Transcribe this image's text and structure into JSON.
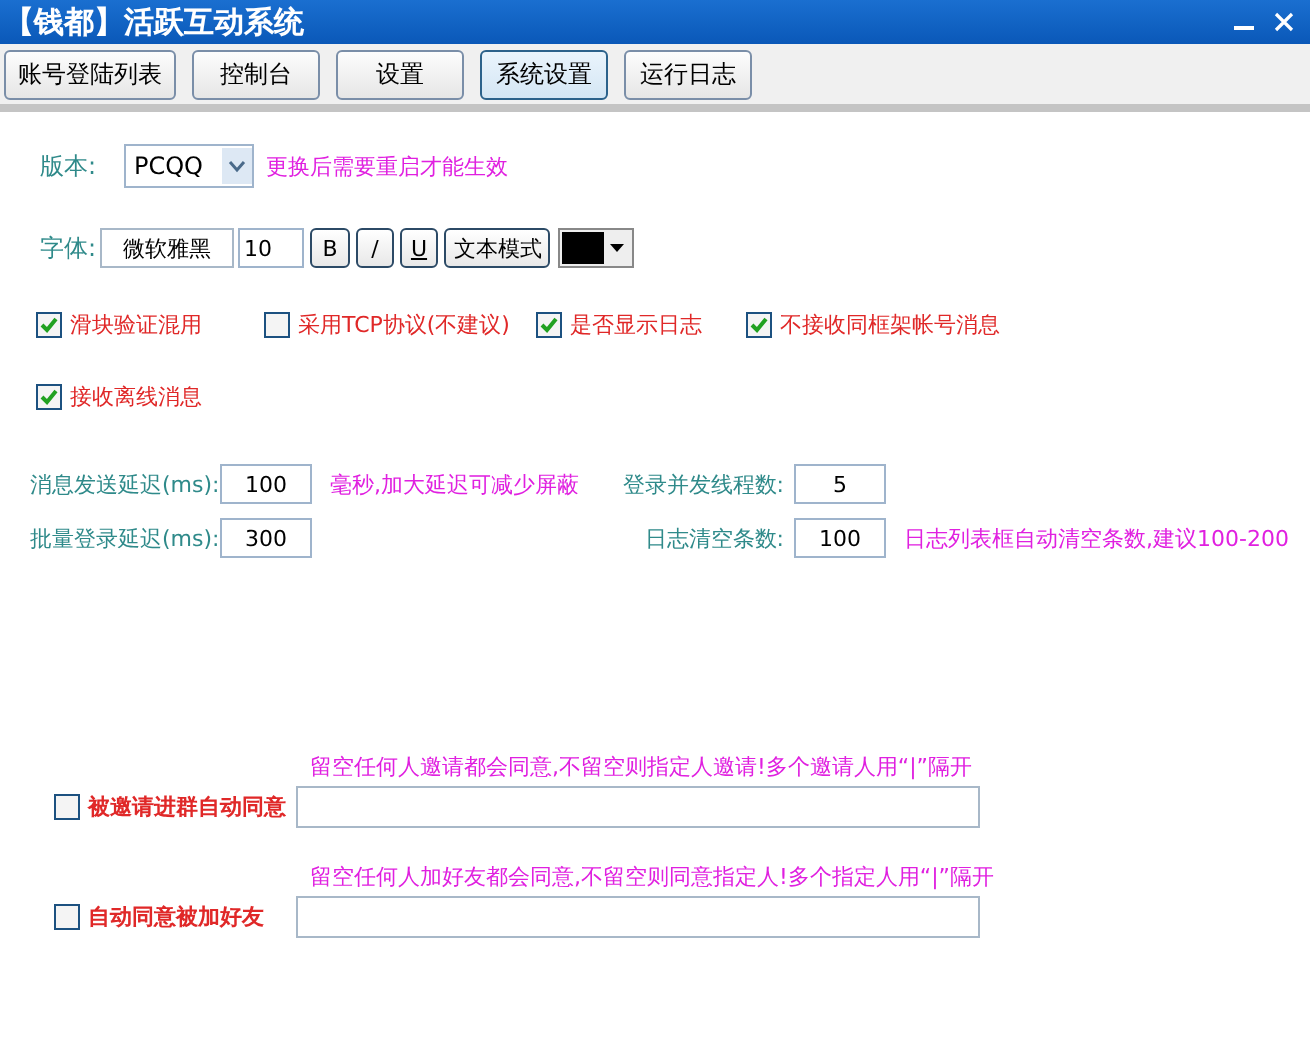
{
  "window": {
    "title": "【钱都】活跃互动系统"
  },
  "tabs": [
    {
      "label": "账号登陆列表",
      "selected": false
    },
    {
      "label": "控制台",
      "selected": false
    },
    {
      "label": "设置",
      "selected": false
    },
    {
      "label": "系统设置",
      "selected": true
    },
    {
      "label": "运行日志",
      "selected": false
    }
  ],
  "version": {
    "label": "版本:",
    "value": "PCQQ",
    "note": "更换后需要重启才能生效"
  },
  "font": {
    "label": "字体:",
    "name": "微软雅黑",
    "size": "10",
    "bold_button": "B",
    "italic_button": "/",
    "underline_button": "U",
    "mode_button": "文本模式",
    "color": "#000000"
  },
  "options": [
    {
      "label": "滑块验证混用",
      "checked": true
    },
    {
      "label": "采用TCP协议(不建议)",
      "checked": false
    },
    {
      "label": "是否显示日志",
      "checked": true
    },
    {
      "label": "不接收同框架帐号消息",
      "checked": true
    },
    {
      "label": "接收离线消息",
      "checked": true
    }
  ],
  "left_fields": [
    {
      "label": "消息发送延迟(ms):",
      "value": "100",
      "note": "毫秒,加大延迟可减少屏蔽"
    },
    {
      "label": "批量登录延迟(ms):",
      "value": "300"
    }
  ],
  "right_fields": [
    {
      "label": "登录并发线程数:",
      "value": "5"
    },
    {
      "label": "日志清空条数:",
      "value": "100",
      "note": "日志列表框自动清空条数,建议100-200"
    }
  ],
  "auto_accept": [
    {
      "note": "留空任何人邀请都会同意,不留空则指定人邀请!多个邀请人用“|”隔开",
      "label": "被邀请进群自动同意",
      "checked": false
    },
    {
      "note": "留空任何人加好友都会同意,不留空则同意指定人!多个指定人用“|”隔开",
      "label": "自动同意被加好友",
      "checked": false
    }
  ]
}
